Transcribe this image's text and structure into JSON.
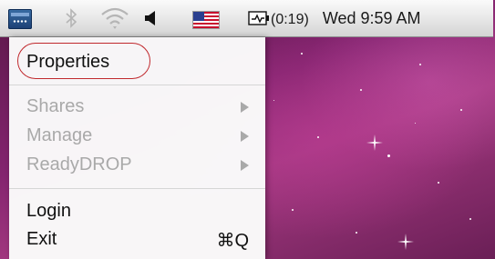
{
  "menubar": {
    "battery_percent": "(0:19)",
    "clock": "Wed 9:59 AM",
    "icons": [
      "app-tray-icon",
      "bluetooth-icon",
      "wifi-icon",
      "speaker-icon",
      "us-flag-icon",
      "battery-icon"
    ]
  },
  "menu": {
    "items": [
      {
        "label": "Properties",
        "enabled": true
      },
      {
        "label": "Shares",
        "enabled": false,
        "submenu": true
      },
      {
        "label": "Manage",
        "enabled": false,
        "submenu": true
      },
      {
        "label": "ReadyDROP",
        "enabled": false,
        "submenu": true
      },
      {
        "label": "Login",
        "enabled": true
      },
      {
        "label": "Exit",
        "enabled": true,
        "shortcut": "⌘Q"
      }
    ]
  },
  "colors": {
    "highlight_oval": "#c0282d",
    "disabled_text": "#a9a9a9",
    "desktop": "#84246f"
  }
}
